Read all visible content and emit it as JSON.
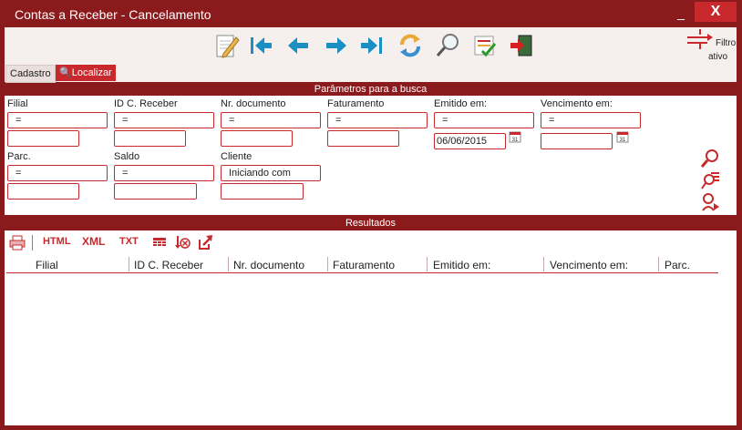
{
  "window": {
    "title": "Contas a Receber - Cancelamento",
    "minimize": "_",
    "close": "X"
  },
  "toolbar": {
    "icons": [
      "edit-icon",
      "first-icon",
      "previous-icon",
      "next-icon",
      "last-icon",
      "refresh-icon",
      "search-icon",
      "checklist-icon",
      "exit-icon"
    ],
    "filter_label": "Filtro",
    "filter_label2": "ativo"
  },
  "tabs": {
    "cadastro": "Cadastro",
    "localizar": "Localizar"
  },
  "params": {
    "header": "Parâmetros para a busca",
    "filial": {
      "label": "Filial",
      "op": "=",
      "value": ""
    },
    "id_receber": {
      "label": "ID C. Receber",
      "op": "=",
      "value": ""
    },
    "nr_documento": {
      "label": "Nr. documento",
      "op": "=",
      "value": ""
    },
    "faturamento": {
      "label": "Faturamento",
      "op": "=",
      "value": ""
    },
    "emitido": {
      "label": "Emitido em:",
      "op": "=",
      "value": "06/06/2015"
    },
    "vencimento": {
      "label": "Vencimento em:",
      "op": "=",
      "value": ""
    },
    "parc": {
      "label": "Parc.",
      "op": "=",
      "value": ""
    },
    "saldo": {
      "label": "Saldo",
      "op": "=",
      "value": ""
    },
    "cliente": {
      "label": "Cliente",
      "op": "Iniciando com",
      "value": ""
    }
  },
  "results": {
    "header": "Resultados",
    "html": "HTML",
    "xml": "XML",
    "txt": "TXT",
    "columns": [
      "Filial",
      "ID C. Receber",
      "Nr. documento",
      "Faturamento",
      "Emitido em:",
      "Vencimento em:",
      "Parc."
    ]
  },
  "colors": {
    "accent": "#c8292d",
    "frame": "#8b1a1c"
  }
}
